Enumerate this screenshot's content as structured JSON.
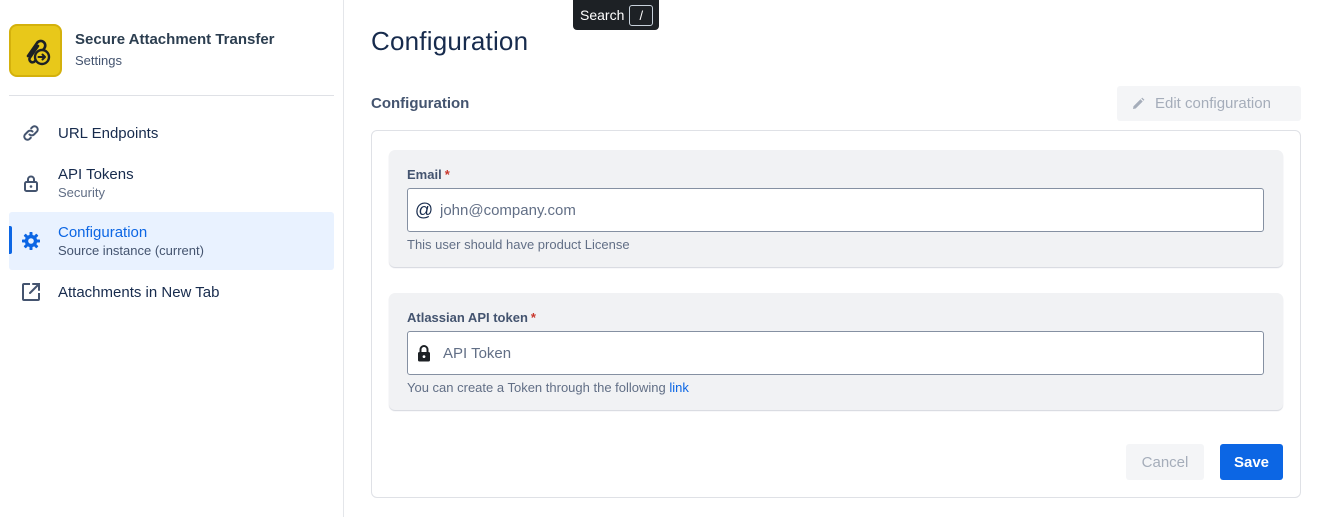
{
  "app": {
    "title": "Secure Attachment Transfer",
    "subtitle": "Settings",
    "logo_icon": "attachment-transfer-logo",
    "logo_color": "#e8c81a"
  },
  "sidebar": {
    "items": [
      {
        "label": "URL Endpoints",
        "description": "",
        "icon": "link-icon",
        "active": false
      },
      {
        "label": "API Tokens",
        "description": "Security",
        "icon": "lock-icon",
        "active": false
      },
      {
        "label": "Configuration",
        "description": "Source instance (current)",
        "icon": "gear-icon",
        "active": true
      },
      {
        "label": "Attachments in New Tab",
        "description": "",
        "icon": "external-link-icon",
        "active": false
      }
    ]
  },
  "search_tooltip": {
    "label": "Search",
    "shortcut": "/"
  },
  "main": {
    "page_title": "Configuration",
    "section_title": "Configuration",
    "edit_button": "Edit configuration"
  },
  "form": {
    "email": {
      "label": "Email",
      "required_mark": "*",
      "placeholder": "john@company.com",
      "value": "",
      "helper": "This user should have product License",
      "icon": "at-icon"
    },
    "token": {
      "label": "Atlassian API token",
      "required_mark": "*",
      "placeholder": "API Token",
      "value": "",
      "helper_prefix": "You can create a Token through the following",
      "helper_link": "link",
      "icon": "lock-icon"
    },
    "cancel_label": "Cancel",
    "save_label": "Save"
  },
  "colors": {
    "accent": "#0c66e4",
    "active_bg": "#e9f2ff",
    "required": "#c9372c"
  }
}
